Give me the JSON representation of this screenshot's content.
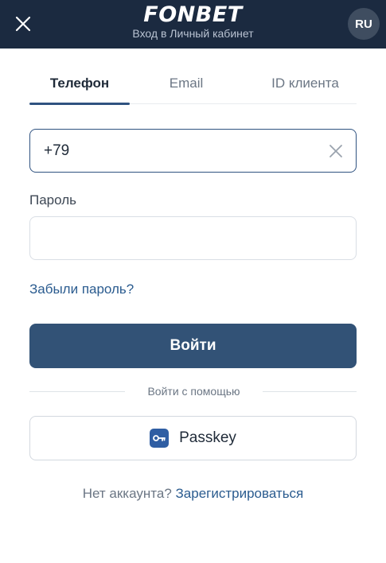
{
  "header": {
    "logo": "FONBET",
    "subtitle": "Вход в Личный кабинет",
    "language": "RU",
    "background_color": "#1b2a40",
    "close_icon": "close-icon"
  },
  "tabs": [
    {
      "label": "Телефон",
      "active": true
    },
    {
      "label": "Email",
      "active": false
    },
    {
      "label": "ID клиента",
      "active": false
    }
  ],
  "phone": {
    "value": "+79",
    "clear_icon": "close-icon"
  },
  "password": {
    "label": "Пароль",
    "value": ""
  },
  "forgot_link": "Забыли пароль?",
  "login_button": "Войти",
  "divider_text": "Войти с помощью",
  "passkey": {
    "label": "Passkey",
    "icon": "key-icon"
  },
  "register": {
    "prompt": "Нет аккаунта?",
    "link": "Зарегистрироваться"
  },
  "colors": {
    "accent": "#2f5280",
    "button": "#325276",
    "link": "#2a5b8f"
  }
}
